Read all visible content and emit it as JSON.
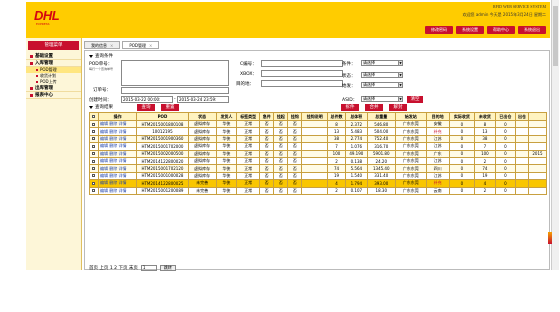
{
  "header": {
    "logo": "DHL",
    "logo_sub": "EXPRESS",
    "sys_title": "RFID WEB SERVICE SYSTEM",
    "user_info": "欢迎您 admin 今天是 2015年3月24日 星期二",
    "buttons": [
      "修改密码",
      "系统设置",
      "帮助中心",
      "系统退出"
    ]
  },
  "sidebar": {
    "title": "管理菜单",
    "groups": [
      {
        "label": "基础设置",
        "items": []
      },
      {
        "label": "入库管理",
        "items": [
          "POD管理",
          "收货计划",
          "POD上传"
        ]
      },
      {
        "label": "出库管理",
        "items": []
      },
      {
        "label": "报表中心",
        "items": []
      }
    ],
    "active_item": "POD管理"
  },
  "tabs": [
    {
      "label": "我的信息"
    },
    {
      "label": "POD管理"
    }
  ],
  "query": {
    "title": "查询条件",
    "pod_label": "POD单号：",
    "pod_hint": "每行一个查询单号",
    "cno_label": "C编号：",
    "xbox_label": "XBOX：",
    "dest_label": "目的地：",
    "order_label": "订单号：",
    "created_label": "创建时间：",
    "created_from": "2015-03-22 00:00:",
    "created_to": "2015-03-24 23:59:",
    "condition_label": "条件：",
    "status_label": "状态：",
    "origin_label": "始发：",
    "asid_label": "ASID：",
    "select_placeholder": "请选择",
    "clear_btn": "清空",
    "search_btn": "查询",
    "reset_btn": "重置",
    "result_title": "查询结果",
    "action_btns": [
      "拆件",
      "合并",
      "解封"
    ]
  },
  "table": {
    "columns": [
      "",
      "操作",
      "POD",
      "状态",
      "发货人",
      "标签类型",
      "急件",
      "挂起",
      "挂钩",
      "挂钩说明",
      "总件数",
      "总体积",
      "总重量",
      "始发站",
      "目的地",
      "实际收货",
      "未收货",
      "已出仓",
      "出仓",
      ""
    ],
    "ops": [
      "编辑",
      "删除",
      "详情"
    ],
    "rows": [
      [
        "HTM2015001800108",
        "虚拟库存",
        "华侠",
        "正常",
        "否",
        "否",
        "否",
        "",
        "8",
        "2.372",
        "546.80",
        "广东东莞",
        "安徽",
        "0",
        "8",
        "0",
        "",
        ""
      ],
      [
        "10012195",
        "虚拟库存",
        "华侠",
        "正常",
        "否",
        "否",
        "否",
        "",
        "13",
        "5.483",
        "504.00",
        "广东东莞",
        "补充",
        "0",
        "13",
        "0",
        "",
        ""
      ],
      [
        "HTM2015001900360",
        "虚拟库存",
        "华侠",
        "正常",
        "否",
        "否",
        "否",
        "",
        "38",
        "2.774",
        "752.40",
        "广东东莞",
        "江苏",
        "0",
        "38",
        "0",
        "",
        ""
      ],
      [
        "HTM2015001702000",
        "虚拟库存",
        "华侠",
        "正常",
        "否",
        "否",
        "否",
        "",
        "7",
        "1.076",
        "316.70",
        "广东东莞",
        "江苏",
        "0",
        "7",
        "0",
        "",
        ""
      ],
      [
        "HTM2015002000500",
        "虚拟库存",
        "华侠",
        "正常",
        "否",
        "否",
        "否",
        "",
        "100",
        "49.190",
        "5901.80",
        "广东东莞",
        "广东",
        "0",
        "100",
        "0",
        "",
        "2015"
      ],
      [
        "HTM2014122800020",
        "虚拟库存",
        "华侠",
        "正常",
        "否",
        "否",
        "否",
        "",
        "2",
        "0.138",
        "24.20",
        "广东东莞",
        "江苏",
        "0",
        "2",
        "0",
        "",
        ""
      ],
      [
        "HTM2015001702120",
        "虚拟库存",
        "华侠",
        "正常",
        "否",
        "否",
        "否",
        "",
        "74",
        "5.564",
        "1345.40",
        "广东东莞",
        "四川",
        "0",
        "74",
        "0",
        "",
        ""
      ],
      [
        "HTM2015001000028",
        "虚拟库存",
        "华侠",
        "正常",
        "否",
        "否",
        "否",
        "",
        "19",
        "1.540",
        "331.40",
        "广东东莞",
        "江苏",
        "0",
        "19",
        "0",
        "",
        ""
      ],
      [
        "HTM2014122800025",
        "未完善",
        "华侠",
        "正常",
        "否",
        "否",
        "否",
        "",
        "4",
        "1.794",
        "393.00",
        "广东东莞",
        "补充",
        "0",
        "4",
        "0",
        "",
        ""
      ],
      [
        "HTM2015001200089",
        "未完善",
        "华侠",
        "正常",
        "否",
        "否",
        "否",
        "",
        "2",
        "0.107",
        "18.30",
        "广东东莞",
        "云南",
        "0",
        "2",
        "0",
        "",
        ""
      ]
    ]
  },
  "pager": {
    "text": "首页 上页 1 2 下页 末页",
    "page_value": "1",
    "go_btn": "跳转"
  }
}
